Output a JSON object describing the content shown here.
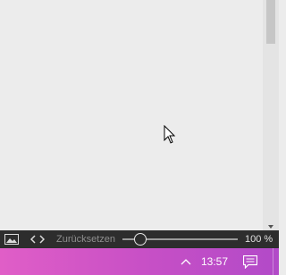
{
  "toolbar": {
    "image_icon": "image-icon",
    "code_icon": "code-icon",
    "reset_label": "Zurücksetzen",
    "zoom_label": "100 %",
    "zoom_level_fraction": 0.15
  },
  "taskbar": {
    "time": "13:57",
    "chevron_icon": "chevron-up-icon",
    "notification_icon": "action-center-icon",
    "accent_gradient": [
      "#e05ec7",
      "#b24ac8"
    ]
  },
  "colors": {
    "canvas": "#ececec",
    "toolbar_bg": "#2d2d2d"
  }
}
